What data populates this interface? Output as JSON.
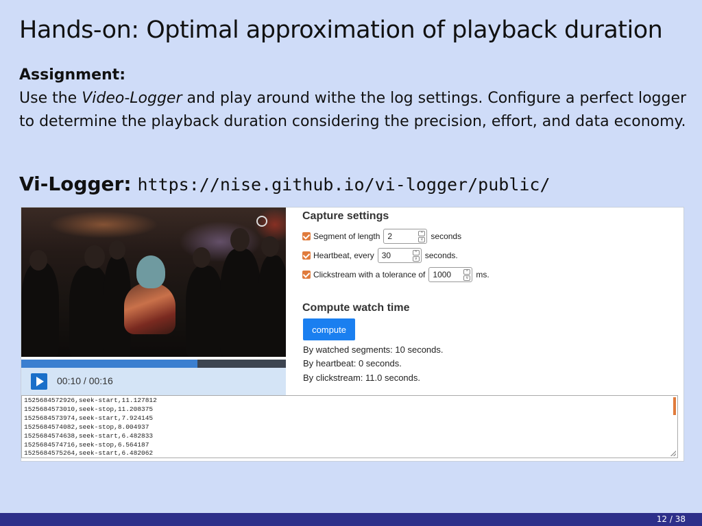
{
  "slide": {
    "title": "Hands-on: Optimal approximation of playback duration",
    "assignment_head": "Assignment:",
    "assignment_pre": "Use the ",
    "assignment_em": "Video-Logger",
    "assignment_post": " and play around withe the log settings. Configure a perfect logger to determine the playback duration considering the precision, effort, and data economy.",
    "vilogger_label": "Vi-Logger:",
    "vilogger_url": "https://nise.github.io/vi-logger/public/",
    "page": "12 / 38"
  },
  "player": {
    "time": "00:10 / 00:16",
    "progress_fraction": 0.667
  },
  "capture": {
    "heading": "Capture settings",
    "segment_label": "Segment of length",
    "segment_value": "2",
    "segment_unit": "seconds",
    "heartbeat_label": "Heartbeat, every",
    "heartbeat_value": "30",
    "heartbeat_unit": "seconds.",
    "clickstream_label": "Clickstream with a tolerance of",
    "clickstream_value": "1000",
    "clickstream_unit": "ms."
  },
  "compute": {
    "heading": "Compute watch time",
    "button": "compute",
    "by_segments": "By watched segments: 10 seconds.",
    "by_heartbeat": "By heartbeat: 0 seconds.",
    "by_clickstream": "By clickstream: 11.0 seconds."
  },
  "log_lines": [
    "1525684572926,seek-start,11.127812",
    "1525684573010,seek-stop,11.208375",
    "1525684573974,seek-start,7.924145",
    "1525684574082,seek-stop,8.004937",
    "1525684574638,seek-start,6.482833",
    "1525684574716,seek-stop,6.564187",
    "1525684575264,seek-start,6.482062"
  ],
  "colors": {
    "slide_bg": "#cfdcf8",
    "footer": "#2d2f8a",
    "accent_blue": "#1a7ff0",
    "checkbox": "#e07b3c"
  }
}
